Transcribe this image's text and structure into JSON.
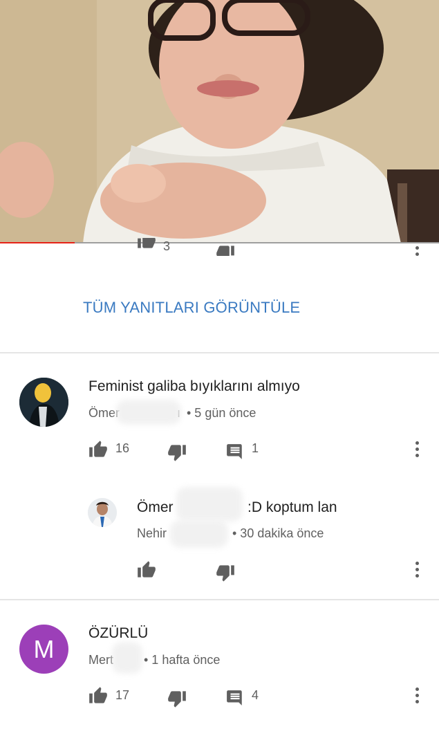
{
  "video": {
    "progress_percent": 17
  },
  "thread_top": {
    "like_count": "3"
  },
  "view_all_replies_label": "TÜM YANITLARI GÖRÜNTÜLE",
  "comments": [
    {
      "text": "Feminist galiba bıyıklarını almıyo",
      "author": "Ömer",
      "author_tail": "ı",
      "time": "• 5 gün önce",
      "like_count": "16",
      "reply_count": "1"
    },
    {
      "text_prefix": "Ömer",
      "text": ":D koptum lan",
      "author": "Nehir",
      "time": "• 30 dakika önce"
    },
    {
      "text": "ÖZÜRLÜ",
      "avatar_letter": "M",
      "author": "Mert",
      "time": "• 1 hafta önce",
      "like_count": "17",
      "reply_count": "4"
    }
  ],
  "colors": {
    "link": "#3a7ac1",
    "progress": "#e62117",
    "avatar_m": "#9c3fb8",
    "meta_text": "#606060"
  }
}
